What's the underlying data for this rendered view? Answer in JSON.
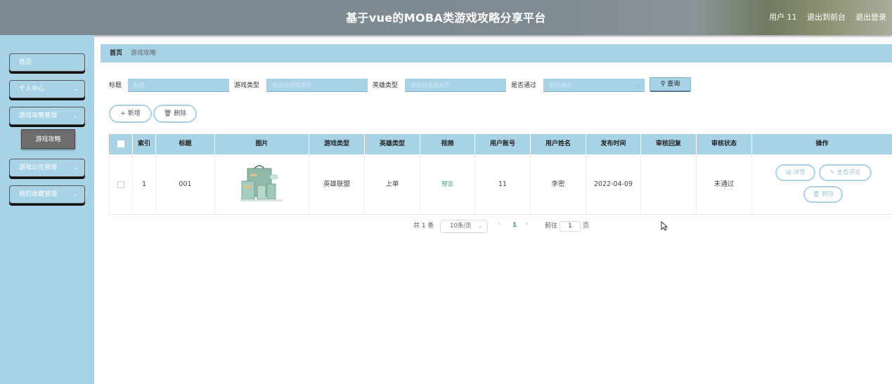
{
  "header": {
    "title": "基于vue的MOBA类游戏攻略分享平台",
    "user_label": "用户 11",
    "back_frontend": "退出到前台",
    "logout": "退出登录"
  },
  "sidebar": {
    "items": [
      {
        "label": "首页"
      },
      {
        "label": "个人中心"
      },
      {
        "label": "游戏攻略管理"
      },
      {
        "label": "游戏攻略"
      },
      {
        "label": "游戏公告管理"
      },
      {
        "label": "我的收藏管理"
      }
    ]
  },
  "breadcrumb": {
    "home": "首页",
    "current": "游戏攻略"
  },
  "search": {
    "title_label": "标题",
    "title_placeholder": "标题",
    "game_type_label": "游戏类型",
    "game_type_placeholder": "请选择游戏类型",
    "hero_type_label": "英雄类型",
    "hero_type_placeholder": "请选择英雄类型",
    "pass_label": "是否通过",
    "pass_placeholder": "是否通过",
    "query_button": "查询"
  },
  "actions": {
    "add": "新增",
    "delete": "删除"
  },
  "table": {
    "headers": [
      "索引",
      "标题",
      "图片",
      "游戏类型",
      "英雄类型",
      "视频",
      "用户账号",
      "用户姓名",
      "发布时间",
      "审核回复",
      "审核状态",
      "操作"
    ],
    "rows": [
      {
        "index": "1",
        "title": "001",
        "game_type": "英雄联盟",
        "hero_type": "上单",
        "video": "预览",
        "account": "11",
        "name": "李密",
        "publish_time": "2022-04-09",
        "review_reply": "",
        "review_status": "未通过",
        "ops": {
          "detail": "详情",
          "comments": "查看评论",
          "delete": "删除"
        }
      }
    ]
  },
  "pagination": {
    "total": "共 1 条",
    "page_size": "10条/页",
    "current_page": "1",
    "goto_prefix": "前往",
    "goto_value": "1",
    "goto_suffix": "页"
  },
  "colors": {
    "accent": "#a8d3e6",
    "header": "#7f8a92",
    "link": "#3aa06a"
  }
}
